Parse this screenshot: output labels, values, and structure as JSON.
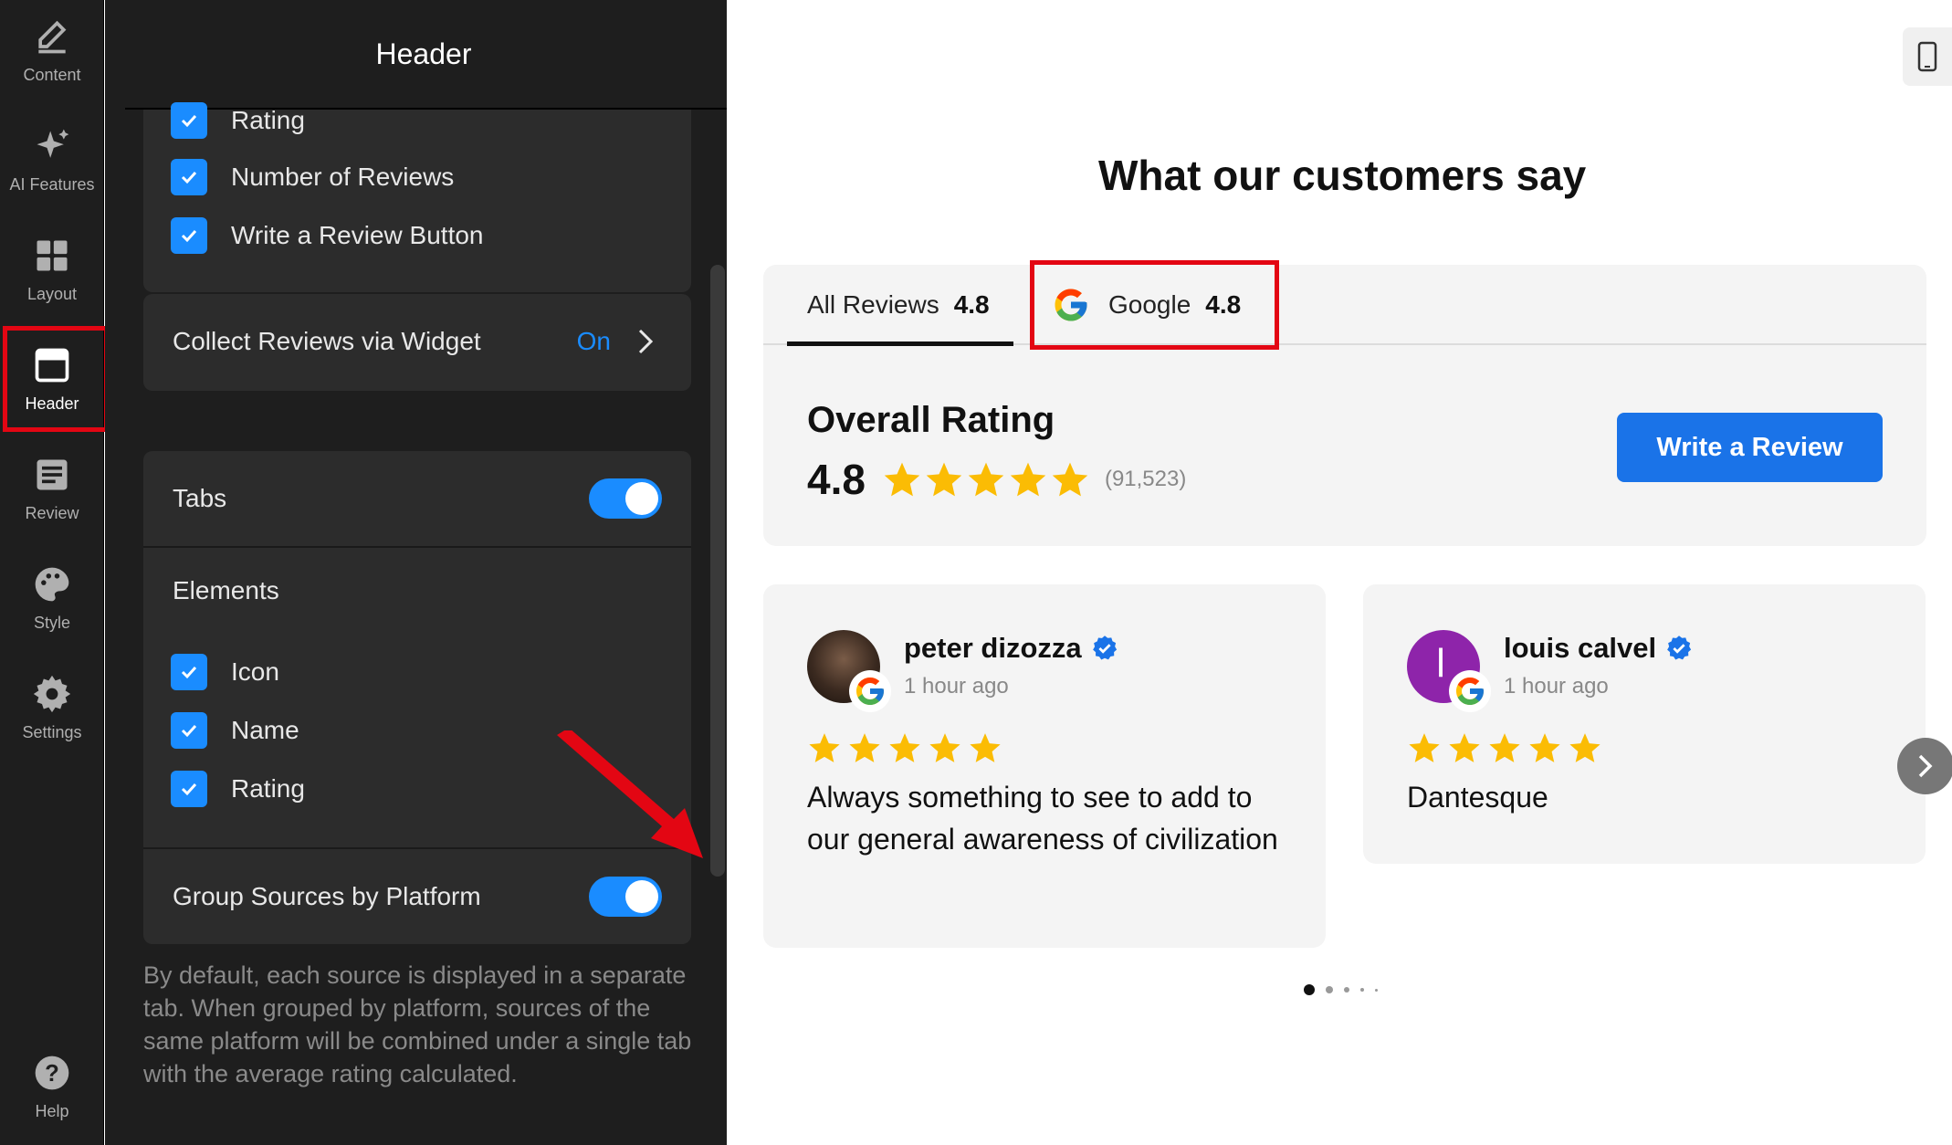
{
  "rail": {
    "items": [
      {
        "label": "Content",
        "icon": "pencil-icon"
      },
      {
        "label": "AI Features",
        "icon": "sparkle-icon"
      },
      {
        "label": "Layout",
        "icon": "layout-icon"
      },
      {
        "label": "Header",
        "icon": "header-icon",
        "active": true
      },
      {
        "label": "Review",
        "icon": "review-icon"
      },
      {
        "label": "Style",
        "icon": "palette-icon"
      },
      {
        "label": "Settings",
        "icon": "gear-icon"
      }
    ],
    "help_label": "Help"
  },
  "panel": {
    "title": "Header",
    "top_checks": [
      "Rating",
      "Number of Reviews",
      "Write a Review Button"
    ],
    "collect_label": "Collect Reviews via Widget",
    "collect_value": "On",
    "tabs_label": "Tabs",
    "elements_label": "Elements",
    "element_checks": [
      "Icon",
      "Name",
      "Rating"
    ],
    "group_label": "Group Sources by Platform",
    "help_text": "By default, each source is displayed in a separate tab. When grouped by platform, sources of the same platform will be combined under a single tab with the average rating calculated."
  },
  "preview": {
    "heading": "What our customers say",
    "tabs": [
      {
        "label": "All Reviews",
        "rating": "4.8"
      },
      {
        "label": "Google",
        "rating": "4.8"
      }
    ],
    "overall_title": "Overall Rating",
    "overall_rating": "4.8",
    "overall_count": "(91,523)",
    "write_button": "Write a Review",
    "reviews": [
      {
        "name": "peter dizozza",
        "time": "1 hour ago",
        "text": "Always something to see to add to our general awareness of civilization",
        "stars": 5
      },
      {
        "name": "louis calvel",
        "time": "1 hour ago",
        "text": "Dantesque",
        "stars": 5,
        "initial": "l"
      }
    ]
  },
  "colors": {
    "accent": "#1a8cff",
    "highlight": "#e30613",
    "star": "#fbbc04",
    "button": "#1a73e8"
  }
}
